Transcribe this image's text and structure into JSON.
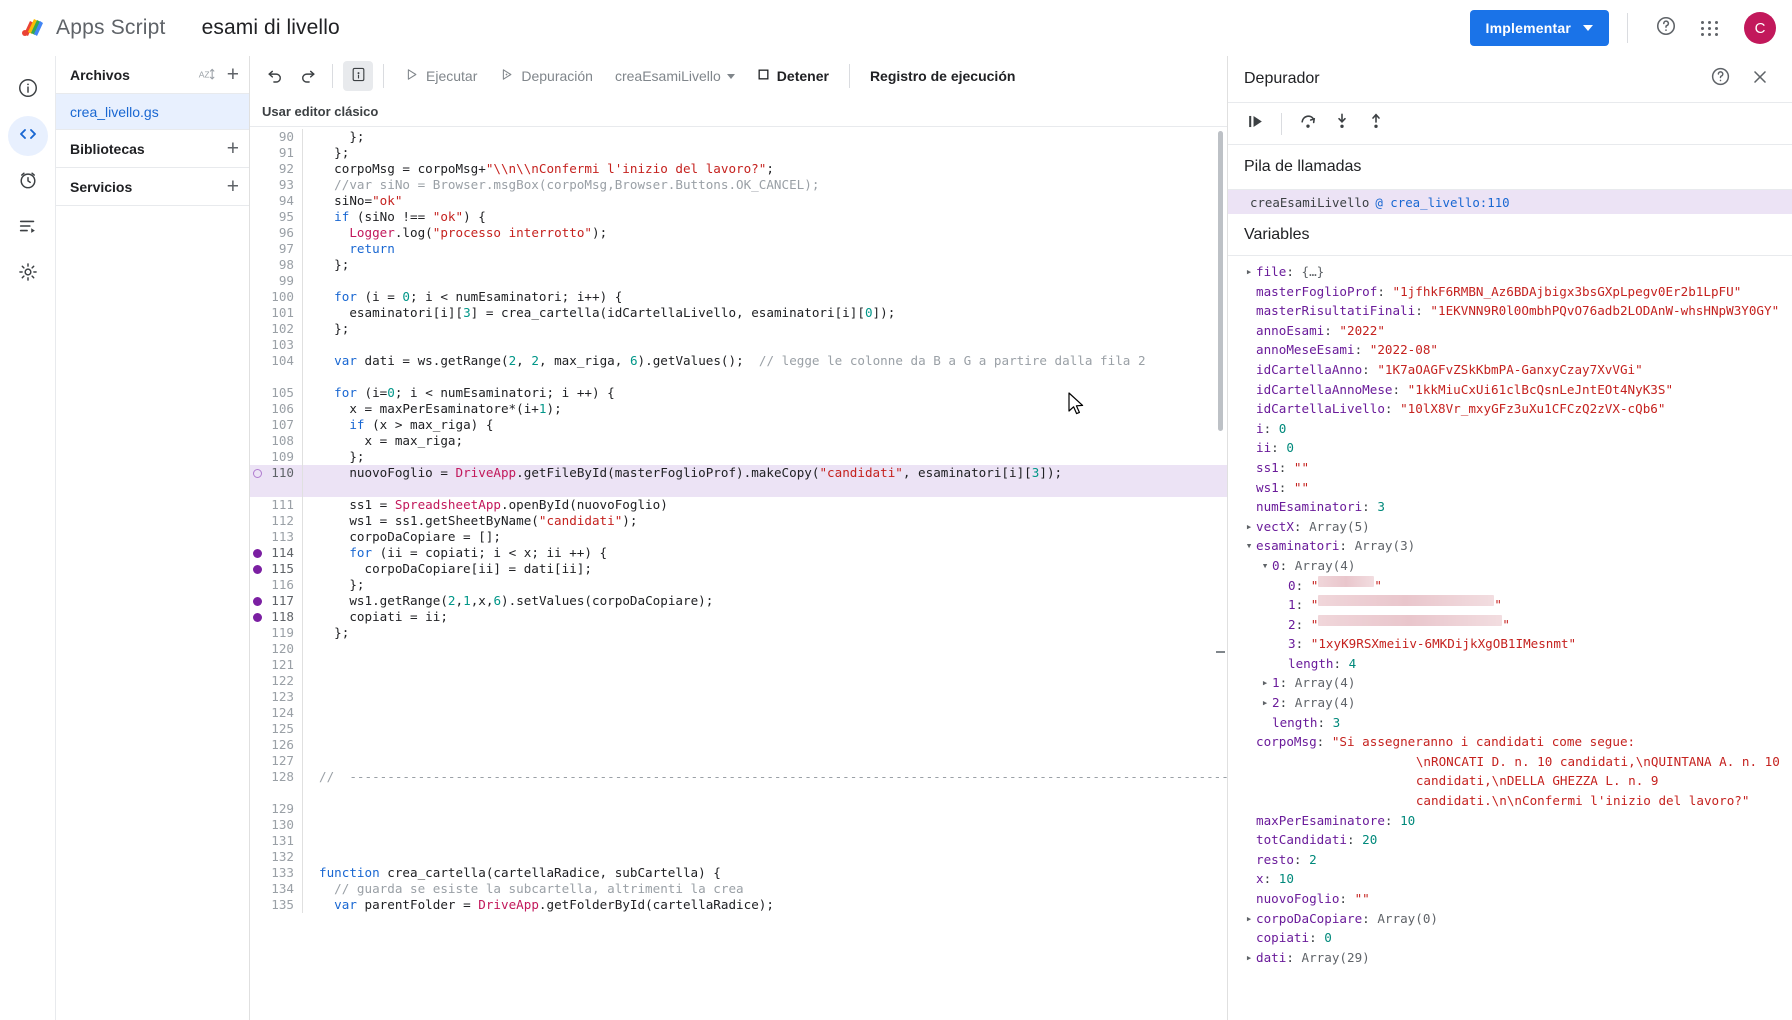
{
  "topbar": {
    "brand": "Apps Script",
    "project_title": "esami di livello",
    "deploy_label": "Implementar",
    "help_icon": "help-circle-icon",
    "apps_icon": "apps-grid-icon",
    "avatar_letter": "C",
    "accent_blue": "#1a73e8",
    "avatar_color": "#c2185b"
  },
  "rail": {
    "items": [
      {
        "name": "overview",
        "icon": "info-circle-icon"
      },
      {
        "name": "editor",
        "icon": "code-brackets-icon",
        "active": true
      },
      {
        "name": "triggers",
        "icon": "alarm-clock-icon"
      },
      {
        "name": "executions",
        "icon": "execution-list-icon"
      },
      {
        "name": "settings",
        "icon": "gear-icon"
      }
    ]
  },
  "filepane": {
    "files_label": "Archivos",
    "sort_icon": "sort-az-icon",
    "add_icon": "plus-icon",
    "file_name": "crea_livello.gs",
    "libraries_label": "Bibliotecas",
    "services_label": "Servicios"
  },
  "toolbar": {
    "undo_icon": "undo-icon",
    "redo_icon": "redo-icon",
    "save_icon": "save-icon",
    "run_label": "Ejecutar",
    "debug_label": "Depuración",
    "function_name": "creaEsamiLivello",
    "stop_label": "Detener",
    "log_label": "Registro de ejecución",
    "classic_editor_label": "Usar editor clásico"
  },
  "editor": {
    "current_line": 110,
    "breakpoints": [
      114,
      115,
      117,
      118
    ],
    "pending_breakpoint": 110,
    "lines": [
      {
        "n": 90,
        "text": "    };"
      },
      {
        "n": 91,
        "text": "  };"
      },
      {
        "n": 92,
        "text": "  corpoMsg = corpoMsg+\"\\\\n\\\\nConfermi l'inizio del lavoro?\";"
      },
      {
        "n": 93,
        "text": "  //var siNo = Browser.msgBox(corpoMsg,Browser.Buttons.OK_CANCEL);"
      },
      {
        "n": 94,
        "text": "  siNo=\"ok\""
      },
      {
        "n": 95,
        "text": "  if (siNo !== \"ok\") {"
      },
      {
        "n": 96,
        "text": "    Logger.log(\"processo interrotto\");"
      },
      {
        "n": 97,
        "text": "    return"
      },
      {
        "n": 98,
        "text": "  };"
      },
      {
        "n": 99,
        "text": ""
      },
      {
        "n": 100,
        "text": "  for (i = 0; i < numEsaminatori; i++) {"
      },
      {
        "n": 101,
        "text": "    esaminatori[i][3] = crea_cartella(idCartellaLivello, esaminatori[i][0]);"
      },
      {
        "n": 102,
        "text": "  };"
      },
      {
        "n": 103,
        "text": ""
      },
      {
        "n": 104,
        "text": "  var dati = ws.getRange(2, 2, max_riga, 6).getValues();  // legge le colonne da B a G a partire dalla fila 2"
      },
      {
        "n": 105,
        "text": "  for (i=0; i < numEsaminatori; i ++) {"
      },
      {
        "n": 106,
        "text": "    x = maxPerEsaminatore*(i+1);"
      },
      {
        "n": 107,
        "text": "    if (x > max_riga) {"
      },
      {
        "n": 108,
        "text": "      x = max_riga;"
      },
      {
        "n": 109,
        "text": "    };"
      },
      {
        "n": 110,
        "text": "    nuovoFoglio = DriveApp.getFileById(masterFoglioProf).makeCopy(\"candidati\", esaminatori[i][3]);"
      },
      {
        "n": 111,
        "text": "    ss1 = SpreadsheetApp.openById(nuovoFoglio)"
      },
      {
        "n": 112,
        "text": "    ws1 = ss1.getSheetByName(\"candidati\");"
      },
      {
        "n": 113,
        "text": "    corpoDaCopiare = [];"
      },
      {
        "n": 114,
        "text": "    for (ii = copiati; i < x; ii ++) {"
      },
      {
        "n": 115,
        "text": "      corpoDaCopiare[ii] = dati[ii];"
      },
      {
        "n": 116,
        "text": "    };"
      },
      {
        "n": 117,
        "text": "    ws1.getRange(2,1,x,6).setValues(corpoDaCopiare);"
      },
      {
        "n": 118,
        "text": "    copiati = ii;"
      },
      {
        "n": 119,
        "text": "  };"
      },
      {
        "n": 120,
        "text": ""
      },
      {
        "n": 121,
        "text": ""
      },
      {
        "n": 122,
        "text": ""
      },
      {
        "n": 123,
        "text": ""
      },
      {
        "n": 124,
        "text": ""
      },
      {
        "n": 125,
        "text": ""
      },
      {
        "n": 126,
        "text": ""
      },
      {
        "n": 127,
        "text": ""
      },
      {
        "n": 128,
        "text": "//  ----------------------------------------------------------------------------------------------------------------------"
      },
      {
        "n": 129,
        "text": ""
      },
      {
        "n": 130,
        "text": ""
      },
      {
        "n": 131,
        "text": ""
      },
      {
        "n": 132,
        "text": ""
      },
      {
        "n": 133,
        "text": "function crea_cartella(cartellaRadice, subCartella) {"
      },
      {
        "n": 134,
        "text": "  // guarda se esiste la subcartella, altrimenti la crea"
      },
      {
        "n": 135,
        "text": "  var parentFolder = DriveApp.getFolderById(cartellaRadice);"
      }
    ]
  },
  "debugger": {
    "title": "Depurador",
    "help_icon": "help-circle-icon",
    "close_icon": "close-icon",
    "toolbar": [
      {
        "name": "resume-button",
        "icon": "resume-icon"
      },
      {
        "name": "step-over-button",
        "icon": "step-over-icon"
      },
      {
        "name": "step-into-button",
        "icon": "step-into-icon"
      },
      {
        "name": "step-out-button",
        "icon": "step-out-icon"
      }
    ],
    "call_stack_label": "Pila de llamadas",
    "call_stack_rows": [
      {
        "fn": "creaEsamiLivello",
        "at": "@ crea_livello:110"
      }
    ],
    "variables_label": "Variables",
    "variables": [
      {
        "indent": 0,
        "twisty": "collapsed",
        "key": "file",
        "sep": ": ",
        "val": "{…}",
        "type": "obj"
      },
      {
        "indent": 0,
        "twisty": "none",
        "key": "masterFoglioProf",
        "sep": ": ",
        "val": "\"1jfhkF6RMBN_Az6BDAjbigx3bsGXpLpegv0Er2b1LpFU\"",
        "type": "str"
      },
      {
        "indent": 0,
        "twisty": "none",
        "key": "masterRisultatiFinali",
        "sep": ": ",
        "val": "\"1EKVNN9R0l0OmbhPQvO76adb2LODAnW-whsHNpW3Y0GY\"",
        "type": "str"
      },
      {
        "indent": 0,
        "twisty": "none",
        "key": "annoEsami",
        "sep": ": ",
        "val": "\"2022\"",
        "type": "str"
      },
      {
        "indent": 0,
        "twisty": "none",
        "key": "annoMeseEsami",
        "sep": ": ",
        "val": "\"2022-08\"",
        "type": "str"
      },
      {
        "indent": 0,
        "twisty": "none",
        "key": "idCartellaAnno",
        "sep": ": ",
        "val": "\"1K7aOAGFvZSkKbmPA-GanxyCzay7XvVGi\"",
        "type": "str"
      },
      {
        "indent": 0,
        "twisty": "none",
        "key": "idCartellaAnnoMese",
        "sep": ": ",
        "val": "\"1kkMiuCxUi61clBcQsnLeJntEOt4NyK3S\"",
        "type": "str"
      },
      {
        "indent": 0,
        "twisty": "none",
        "key": "idCartellaLivello",
        "sep": ": ",
        "val": "\"10lX8Vr_mxyGFz3uXu1CFCzQ2zVX-cQb6\"",
        "type": "str"
      },
      {
        "indent": 0,
        "twisty": "none",
        "key": "i",
        "sep": ": ",
        "val": "0",
        "type": "num"
      },
      {
        "indent": 0,
        "twisty": "none",
        "key": "ii",
        "sep": ": ",
        "val": "0",
        "type": "num"
      },
      {
        "indent": 0,
        "twisty": "none",
        "key": "ss1",
        "sep": ": ",
        "val": "\"\"",
        "type": "str"
      },
      {
        "indent": 0,
        "twisty": "none",
        "key": "ws1",
        "sep": ": ",
        "val": "\"\"",
        "type": "str"
      },
      {
        "indent": 0,
        "twisty": "none",
        "key": "numEsaminatori",
        "sep": ": ",
        "val": "3",
        "type": "num"
      },
      {
        "indent": 0,
        "twisty": "collapsed",
        "key": "vectX",
        "sep": ": ",
        "val": "Array(5)",
        "type": "obj"
      },
      {
        "indent": 0,
        "twisty": "expanded",
        "key": "esaminatori",
        "sep": ": ",
        "val": "Array(3)",
        "type": "obj"
      },
      {
        "indent": 1,
        "twisty": "expanded",
        "key": "0",
        "sep": ": ",
        "val": "Array(4)",
        "type": "obj"
      },
      {
        "indent": 2,
        "twisty": "none",
        "key": "0",
        "sep": ": ",
        "val": "\"",
        "type": "redacted",
        "redact_width": 56
      },
      {
        "indent": 2,
        "twisty": "none",
        "key": "1",
        "sep": ": ",
        "val": "\"",
        "type": "redacted",
        "redact_width": 176
      },
      {
        "indent": 2,
        "twisty": "none",
        "key": "2",
        "sep": ": ",
        "val": "\"",
        "type": "redacted",
        "redact_width": 184
      },
      {
        "indent": 2,
        "twisty": "none",
        "key": "3",
        "sep": ": ",
        "val": "\"1xyK9RSXmeiiv-6MKDijkXgOB1IMesnmt\"",
        "type": "str"
      },
      {
        "indent": 2,
        "twisty": "none",
        "key": "length",
        "sep": ": ",
        "val": "4",
        "type": "num"
      },
      {
        "indent": 1,
        "twisty": "collapsed",
        "key": "1",
        "sep": ": ",
        "val": "Array(4)",
        "type": "obj"
      },
      {
        "indent": 1,
        "twisty": "collapsed",
        "key": "2",
        "sep": ": ",
        "val": "Array(4)",
        "type": "obj"
      },
      {
        "indent": 1,
        "twisty": "none",
        "key": "length",
        "sep": ": ",
        "val": "3",
        "type": "num"
      },
      {
        "indent": 0,
        "twisty": "none",
        "key": "corpoMsg",
        "sep": ": ",
        "val": "\"Si assegneranno i candidati come segue: \\nRONCATI D. n. 10 candidati,\\nQUINTANA A. n. 10 candidati,\\nDELLA GHEZZA L. n. 9 candidati.\\n\\nConfermi l'inizio del lavoro?\"",
        "type": "str-wrap"
      },
      {
        "indent": 0,
        "twisty": "none",
        "key": "maxPerEsaminatore",
        "sep": ": ",
        "val": "10",
        "type": "num"
      },
      {
        "indent": 0,
        "twisty": "none",
        "key": "totCandidati",
        "sep": ": ",
        "val": "20",
        "type": "num"
      },
      {
        "indent": 0,
        "twisty": "none",
        "key": "resto",
        "sep": ": ",
        "val": "2",
        "type": "num"
      },
      {
        "indent": 0,
        "twisty": "none",
        "key": "x",
        "sep": ": ",
        "val": "10",
        "type": "num"
      },
      {
        "indent": 0,
        "twisty": "none",
        "key": "nuovoFoglio",
        "sep": ": ",
        "val": "\"\"",
        "type": "str"
      },
      {
        "indent": 0,
        "twisty": "collapsed",
        "key": "corpoDaCopiare",
        "sep": ": ",
        "val": "Array(0)",
        "type": "obj"
      },
      {
        "indent": 0,
        "twisty": "none",
        "key": "copiati",
        "sep": ": ",
        "val": "0",
        "type": "num"
      },
      {
        "indent": 0,
        "twisty": "collapsed",
        "key": "dati",
        "sep": ": ",
        "val": "Array(29)",
        "type": "obj"
      }
    ]
  }
}
